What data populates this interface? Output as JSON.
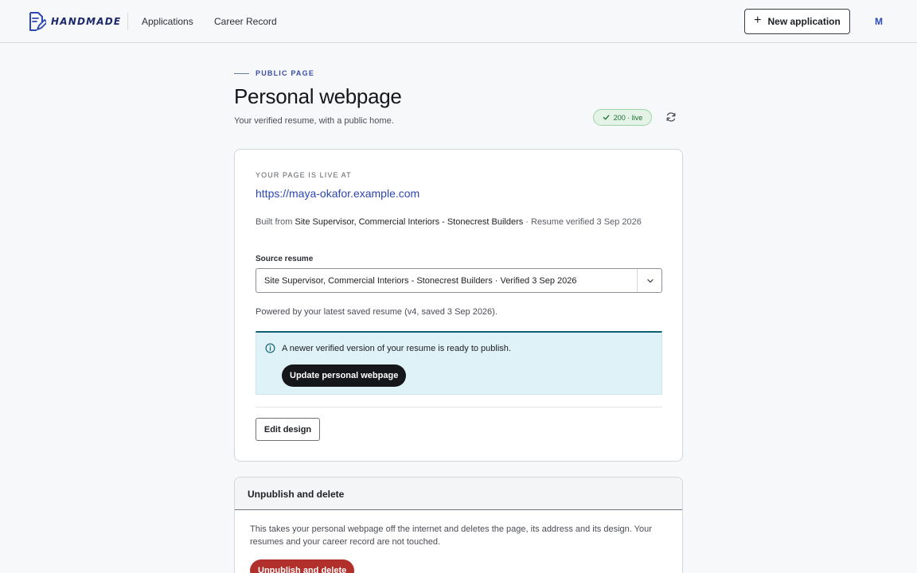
{
  "header": {
    "brand": "HANDMADE",
    "nav": [
      "Applications",
      "Career Record"
    ],
    "new_application_label": "New application",
    "avatar_initial": "M"
  },
  "page": {
    "eyebrow": "PUBLIC PAGE",
    "title": "Personal webpage",
    "subtitle": "Your verified resume, with a public home.",
    "status": "200 · live"
  },
  "live_card": {
    "live_label": "YOUR PAGE IS LIVE AT",
    "url": "https://maya-okafor.example.com",
    "built_from_prefix": "Built from ",
    "built_from_resume": "Site Supervisor, Commercial Interiors - Stonecrest Builders",
    "built_from_suffix": " · Resume verified 3 Sep 2026",
    "source_label": "Source resume",
    "source_selected": "Site Supervisor, Commercial Interiors - Stonecrest Builders · Verified 3 Sep 2026",
    "powered_by": "Powered by your latest saved resume (v4, saved 3 Sep 2026).",
    "notice_text": "A newer verified version of your resume is ready to publish.",
    "update_label": "Update personal webpage",
    "edit_label": "Edit design"
  },
  "danger": {
    "title": "Unpublish and delete",
    "text": "This takes your personal webpage off the internet and deletes the page, its address and its design. Your resumes and your career record are not touched.",
    "button_label": "Unpublish and delete"
  },
  "colors": {
    "accent": "#2d47b0",
    "danger": "#b2302b",
    "notice_bg": "#dff2f8",
    "live_green": "#1f6b34"
  }
}
